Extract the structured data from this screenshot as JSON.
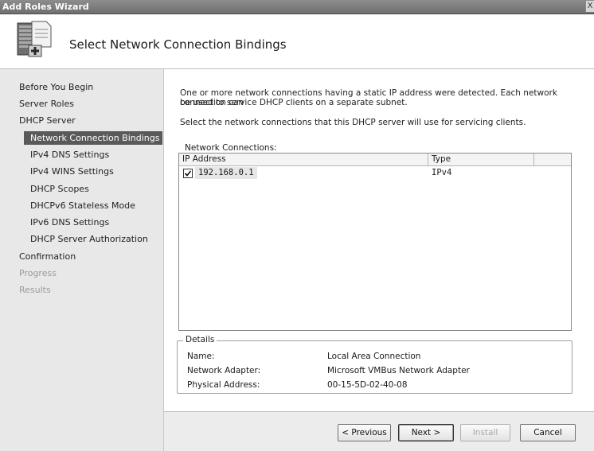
{
  "window": {
    "title": "Add Roles Wizard",
    "close_glyph": "X"
  },
  "header": {
    "title": "Select Network Connection Bindings",
    "icon": "server-wizard-icon"
  },
  "sidebar": {
    "steps": [
      {
        "label": "Before You Begin",
        "state": "normal"
      },
      {
        "label": "Server Roles",
        "state": "normal"
      },
      {
        "label": "DHCP Server",
        "state": "normal"
      },
      {
        "label": "Network Connection Bindings",
        "state": "active"
      },
      {
        "label": "IPv4 DNS Settings",
        "state": "normal"
      },
      {
        "label": "IPv4 WINS Settings",
        "state": "normal"
      },
      {
        "label": "DHCP Scopes",
        "state": "normal"
      },
      {
        "label": "DHCPv6 Stateless Mode",
        "state": "normal"
      },
      {
        "label": "IPv6 DNS Settings",
        "state": "normal"
      },
      {
        "label": "DHCP Server Authorization",
        "state": "normal"
      },
      {
        "label": "Confirmation",
        "state": "normal"
      },
      {
        "label": "Progress",
        "state": "disabled"
      },
      {
        "label": "Results",
        "state": "disabled"
      }
    ]
  },
  "main": {
    "intro_line1": "One or more network connections having a static IP address were detected. Each network connection can",
    "intro_line2": "be used to service DHCP clients on a separate subnet.",
    "instruction": "Select the network connections that this DHCP server will use for servicing clients.",
    "connections_label": "Network Connections:",
    "columns": {
      "ip": "IP Address",
      "type": "Type"
    },
    "rows": [
      {
        "checked": true,
        "ip": "192.168.0.1",
        "type": "IPv4"
      }
    ],
    "details": {
      "legend": "Details",
      "name_label": "Name:",
      "name_value": "Local Area Connection",
      "adapter_label": "Network Adapter:",
      "adapter_value": "Microsoft VMBus Network Adapter",
      "mac_label": "Physical Address:",
      "mac_value": "00-15-5D-02-40-08"
    }
  },
  "buttons": {
    "previous": "< Previous",
    "next": "Next >",
    "install": "Install",
    "cancel": "Cancel"
  }
}
